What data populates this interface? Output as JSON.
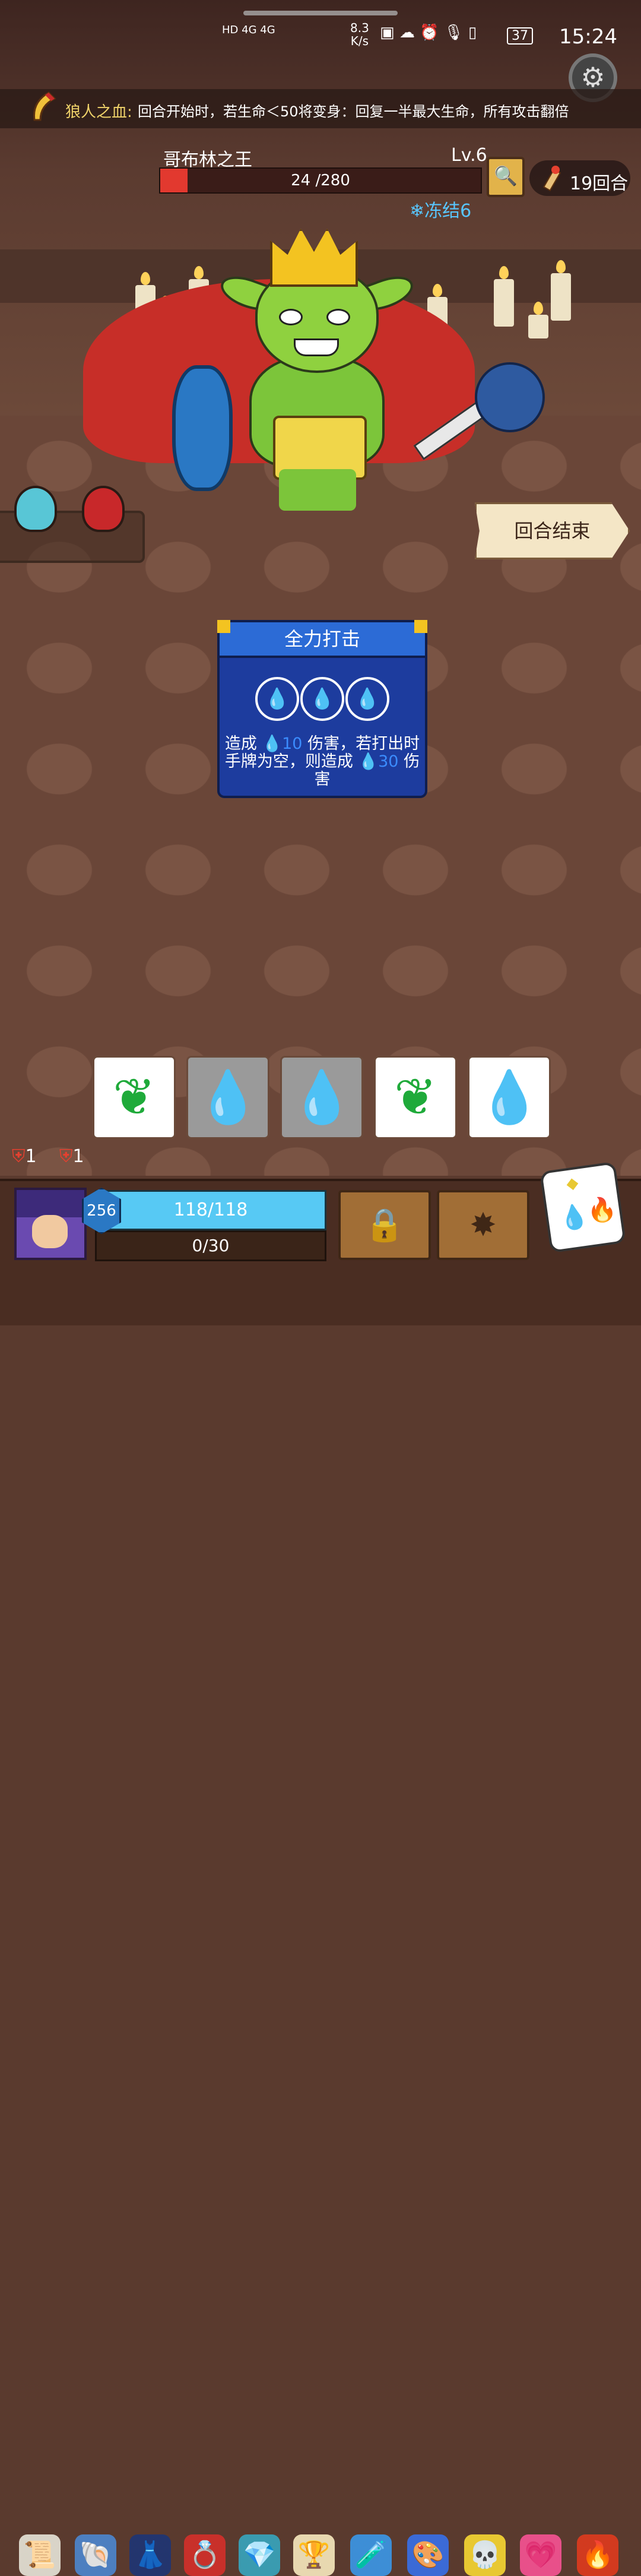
{
  "status_bar": {
    "network_labels": "HD 4G 4G",
    "net_speed_value": "8.3",
    "net_speed_unit": "K/s",
    "battery": "37",
    "time": "15:24"
  },
  "buff": {
    "name": "狼人之血:",
    "description": "回合开始时，若生命＜50将变身：回复一半最大生命，所有攻击翻倍"
  },
  "enemy": {
    "name": "哥布林之王",
    "level": "Lv.6",
    "hp_current": "24",
    "hp_text": "24 /280",
    "hp_fraction": 0.086,
    "status_effect": "冻结6"
  },
  "round_counter": "19回合",
  "end_turn_label": "回合结束",
  "card": {
    "title": "全力打击",
    "cost_count": 3,
    "desc_part1": "造成 ",
    "desc_value1": "10",
    "desc_part2": " 伤害，若打出时手牌为空，则造成 ",
    "desc_value2": "30",
    "desc_part3": " 伤害"
  },
  "dice": [
    {
      "type": "leaf",
      "face": "white",
      "icon": "leaf-icon"
    },
    {
      "type": "water",
      "face": "grey",
      "icon": "water-drop-icon"
    },
    {
      "type": "water",
      "face": "grey",
      "icon": "water-drop-icon"
    },
    {
      "type": "leaf",
      "face": "white",
      "icon": "leaf-icon"
    },
    {
      "type": "water",
      "face": "white",
      "icon": "water-drop-icon"
    }
  ],
  "player": {
    "stat_a": "1",
    "stat_b": "1",
    "armor": "256",
    "hp_text": "118/118",
    "xp_text": "0/30"
  },
  "relics": [
    "scroll-icon",
    "horn-icon",
    "cloak-icon",
    "ring-icon",
    "crystal-crown-icon",
    "goblet-icon",
    "flask-icon",
    "palette-icon",
    "golden-skull-icon",
    "heart-box-icon",
    "fire-bowl-icon"
  ],
  "colors": {
    "hp_red": "#e2392f",
    "player_hp": "#57c9f4",
    "card_blue": "#1d3c9e",
    "freeze_blue": "#58c6ff"
  }
}
